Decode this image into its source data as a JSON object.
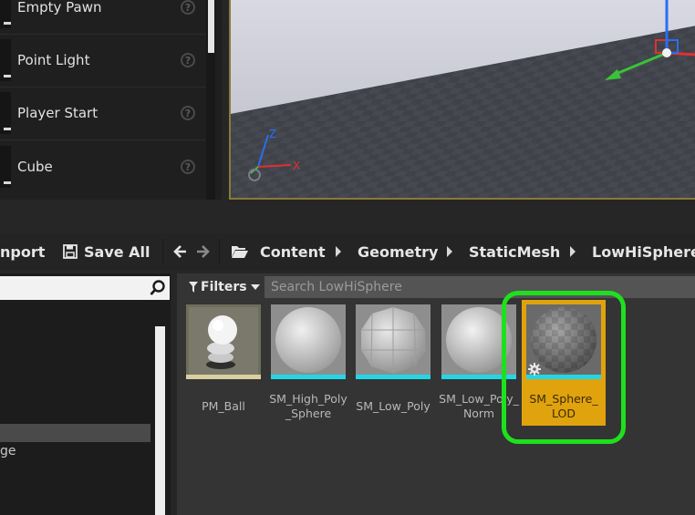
{
  "place_actors": {
    "items": [
      {
        "label": "Empty Pawn",
        "help_icon": "question-circle-icon"
      },
      {
        "label": "Point Light",
        "help_icon": "question-circle-icon"
      },
      {
        "label": "Player Start",
        "help_icon": "question-circle-icon"
      },
      {
        "label": "Cube",
        "help_icon": "question-circle-icon"
      }
    ]
  },
  "viewport": {
    "axis_labels": {
      "z": "Z",
      "x": "X"
    }
  },
  "toolbar": {
    "import_label": "nport",
    "save_all_label": "Save All",
    "breadcrumb": [
      "Content",
      "Geometry",
      "StaticMesh",
      "LowHiSphere"
    ]
  },
  "sources_panel": {
    "partial_label": "ge"
  },
  "asset_view": {
    "filters_label": "Filters",
    "search_placeholder": "Search LowHiSphere",
    "assets": [
      {
        "name_line1": "PM_Ball",
        "name_line2": ""
      },
      {
        "name_line1": "SM_High_Poly",
        "name_line2": "_Sphere"
      },
      {
        "name_line1": "SM_Low_Poly",
        "name_line2": ""
      },
      {
        "name_line1": "SM_Low_Poly_",
        "name_line2": "Norm"
      },
      {
        "name_line1": "SM_Sphere_",
        "name_line2": "LOD"
      }
    ]
  },
  "colors": {
    "selection_orange": "#e0a30e",
    "highlight_green": "#1ee01e",
    "static_mesh_bar": "#22d6e6"
  }
}
